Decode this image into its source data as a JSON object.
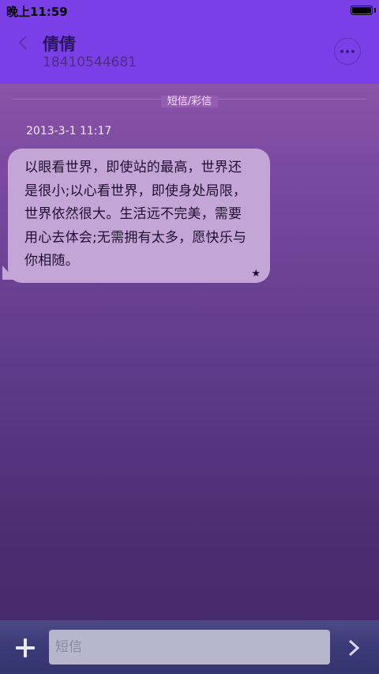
{
  "status_bar": {
    "time": "晚上11:59"
  },
  "header": {
    "contact_name": "倩倩",
    "contact_number": "18410544681",
    "back_icon": "chevron-left-icon",
    "more_icon": "more-horizontal-icon"
  },
  "thread": {
    "channel_label": "短信/彩信",
    "messages": [
      {
        "timestamp": "2013-3-1 11:17",
        "text": "以眼看世界，即使站的最高，世界还是很小;以心看世界，即使身处局限，世界依然很大。生活远不完美，需要用心去体会;无需拥有太多，愿快乐与你相随。",
        "star": "★"
      }
    ]
  },
  "composer": {
    "placeholder": "短信",
    "add_icon": "plus-icon",
    "send_icon": "chevron-right-icon"
  },
  "colors": {
    "header_bg": "#7a3fe6",
    "bubble_bg": "#c3a6d6",
    "composer_bg": "#3b3a78"
  }
}
